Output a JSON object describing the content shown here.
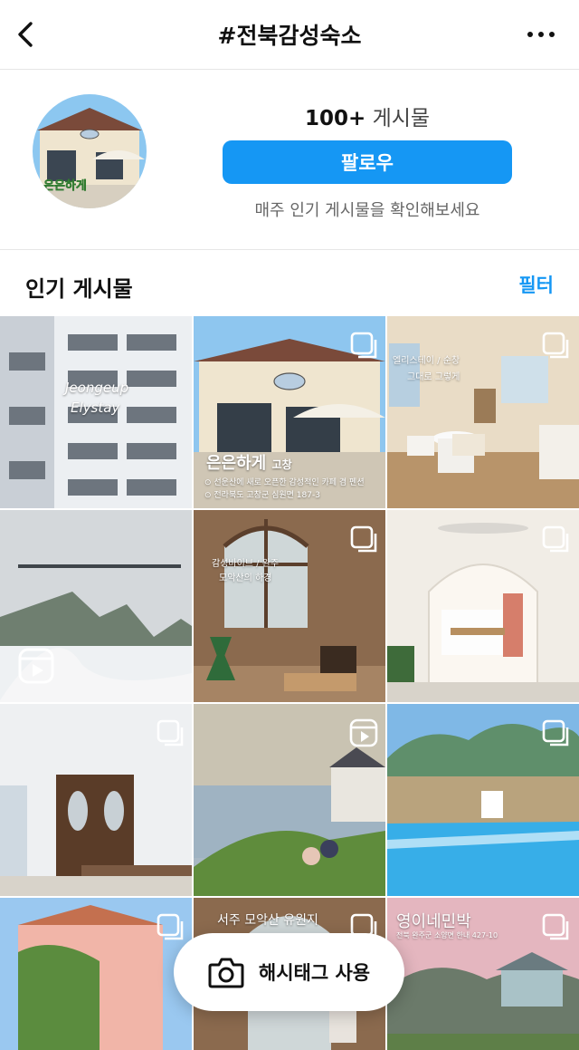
{
  "header": {
    "title": "#전북감성숙소"
  },
  "profile": {
    "post_count": "100+",
    "post_count_label": "게시물",
    "follow_label": "팔로우",
    "subtitle": "매주 인기 게시물을 확인해보세요"
  },
  "section": {
    "title": "인기 게시물",
    "filter_label": "필터"
  },
  "tiles": {
    "t1": {
      "text1": "Jeongeup",
      "text2": "Elystay"
    },
    "t2": {
      "text1": "은은하게",
      "text1_small": "고창",
      "text2": "⊙ 선운산에 새로 오픈한 감성적인 카페 겸 펜션",
      "text3": "⊙ 전라북도 고창군 심원면 187-3"
    },
    "t3": {
      "text1": "엘리스테이 / 순창",
      "text2": "그대로 그렇게"
    },
    "t4": {
      "text1": "감성바이브 / 완주",
      "text2": "모악산의 하경"
    },
    "t10": {
      "text1": "서주 모악산 유원지"
    },
    "t12": {
      "text1": "영이네민박",
      "text2": "전북 완주군 소양면 한내 427-10"
    }
  },
  "hashtag_button": {
    "label": "해시태그 사용"
  }
}
